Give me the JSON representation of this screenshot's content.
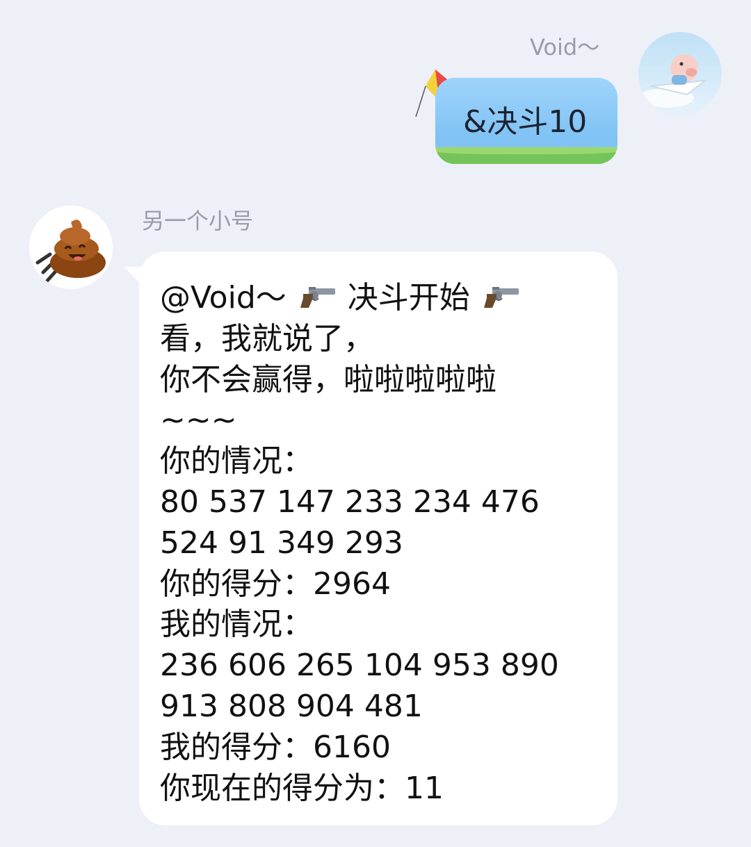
{
  "outgoing": {
    "sender": "Void～",
    "message": "&决斗10"
  },
  "incoming": {
    "sender": "另一个小号",
    "mention": "@Void～",
    "duel_start": "决斗开始",
    "lines": [
      "看，我就说了，",
      "你不会赢得，啦啦啦啦啦",
      "~~~",
      "你的情况：",
      "80 537 147 233 234 476",
      "524 91 349 293",
      "你的得分：2964",
      "我的情况：",
      "236 606 265 104 953 890",
      "913 808 904 481",
      "我的得分：6160",
      "你现在的得分为：11"
    ],
    "emoji": "revolver-emoji"
  },
  "colors": {
    "background": "#eef0f8",
    "outgoing_bubble": "#8cc8f3",
    "incoming_bubble": "#ffffff",
    "name_text": "#9a9ca6"
  }
}
